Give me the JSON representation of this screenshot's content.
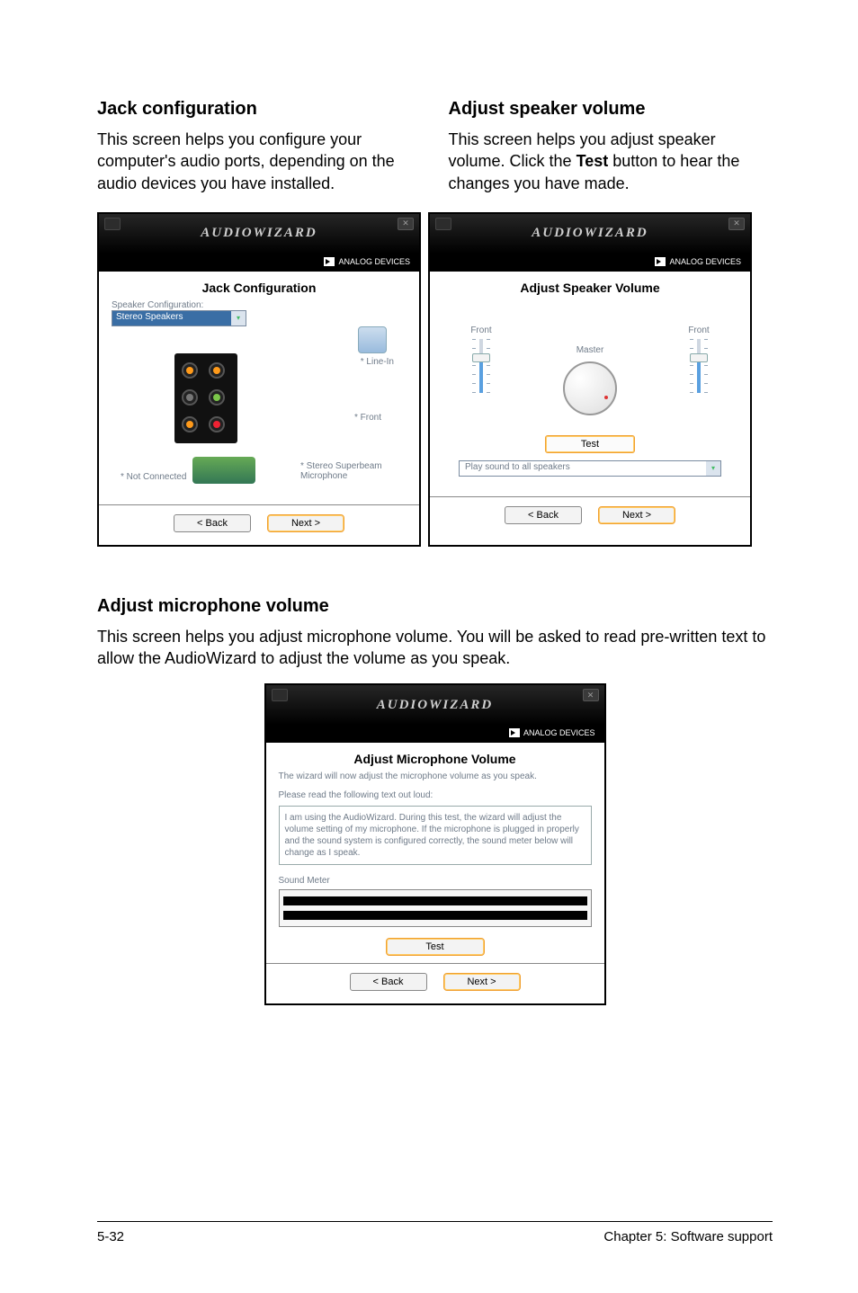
{
  "sections": {
    "jack": {
      "heading": "Jack configuration",
      "paragraph": "This screen helps you configure your computer's audio ports, depending on the audio devices you have installed."
    },
    "speaker": {
      "heading": "Adjust speaker volume",
      "paragraph_before": "This screen helps you adjust speaker volume. Click the ",
      "paragraph_bold": "Test",
      "paragraph_after": " button to hear the changes you have made."
    },
    "mic": {
      "heading": "Adjust microphone volume",
      "paragraph": "This screen helps you adjust microphone volume. You will be asked to read pre-written text to allow the AudioWizard to adjust the volume as you speak."
    }
  },
  "wizard_common": {
    "title": "AudioWizard",
    "brand": "ANALOG DEVICES",
    "back_label": "< Back",
    "next_label": "Next >"
  },
  "jack_panel": {
    "panel_title": "Jack Configuration",
    "config_label": "Speaker Configuration:",
    "combo_value": "Stereo Speakers",
    "tag_linein": "* Line-In",
    "tag_front": "* Front",
    "tag_notconnected": "* Not Connected",
    "tag_mic": "* Stereo Superbeam Microphone"
  },
  "speaker_panel": {
    "panel_title": "Adjust Speaker Volume",
    "front_left": "Front",
    "front_right": "Front",
    "master_label": "Master",
    "test_label": "Test",
    "play_combo": "Play sound to all speakers"
  },
  "mic_panel": {
    "panel_title": "Adjust Microphone Volume",
    "instruction": "The wizard will now adjust the microphone volume as you speak.",
    "sub_instruction": "Please read the following text out loud:",
    "read_text": "I am using the AudioWizard. During this test, the wizard will adjust the volume setting of my microphone. If the microphone is plugged in properly and the sound system is configured correctly, the sound meter below will change as I speak.",
    "meter_label": "Sound Meter",
    "test_label": "Test"
  },
  "footer": {
    "left": "5-32",
    "right": "Chapter 5: Software support"
  }
}
